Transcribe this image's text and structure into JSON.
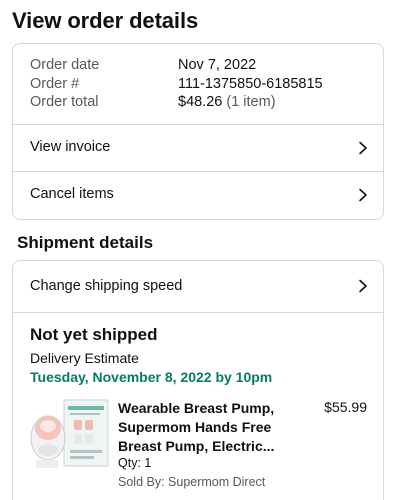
{
  "page": {
    "title": "View order details"
  },
  "summary": {
    "rows": [
      {
        "label": "Order date",
        "value": "Nov 7, 2022"
      },
      {
        "label": "Order #",
        "value": "111-1375850-6185815"
      },
      {
        "label": "Order total",
        "value": "$48.26",
        "extra": "(1 item)"
      }
    ],
    "links": [
      {
        "label": "View invoice",
        "icon": "chevron-right-icon"
      },
      {
        "label": "Cancel items",
        "icon": "chevron-right-icon"
      }
    ]
  },
  "shipment": {
    "section_title": "Shipment details",
    "change_speed_label": "Change shipping speed",
    "status": "Not yet shipped",
    "estimate_label": "Delivery Estimate",
    "estimate_date": "Tuesday, November 8, 2022 by 10pm",
    "product": {
      "name_lines": [
        "Wearable Breast Pump,",
        "Supermom Hands Free",
        "Breast Pump, Electric..."
      ],
      "price": "$55.99",
      "qty": "Qty: 1",
      "seller": "Sold By: Supermom Direct",
      "image_icon": "product-thumbnail"
    }
  },
  "colors": {
    "accent_green": "#067d62",
    "border": "#d5d9d9",
    "muted_text": "#565959"
  }
}
